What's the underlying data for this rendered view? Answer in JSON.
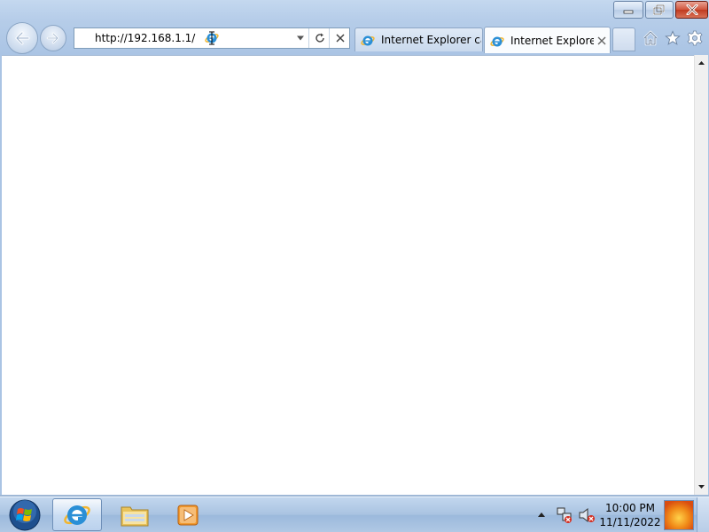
{
  "window": {
    "controls": {
      "minimize": "minimize-icon",
      "restore": "restore-icon",
      "close": "close-icon"
    }
  },
  "navigation": {
    "back": "back-arrow-icon",
    "forward": "forward-arrow-icon"
  },
  "address_bar": {
    "url": "http://192.168.1.1/",
    "dropdown": "chevron-down-icon",
    "refresh": "refresh-icon",
    "stop": "stop-icon"
  },
  "tabs": [
    {
      "label": "Internet Explorer ca...",
      "active": false
    },
    {
      "label": "Internet Explore...",
      "active": true
    }
  ],
  "command_icons": [
    "home-icon",
    "favorites-star-icon",
    "tools-gear-icon"
  ],
  "taskbar": {
    "pinned": [
      "internet-explorer-icon",
      "windows-explorer-icon",
      "media-player-icon"
    ],
    "tray": [
      "show-hidden-icons-arrow",
      "network-disconnected-icon",
      "volume-muted-icon"
    ],
    "clock": {
      "time": "10:00 PM",
      "date": "11/11/2022"
    }
  },
  "colors": {
    "frame": "#b6cde9",
    "close_button": "#c9462b",
    "ie_blue": "#2a8fd6",
    "ie_gold": "#f2b630"
  }
}
